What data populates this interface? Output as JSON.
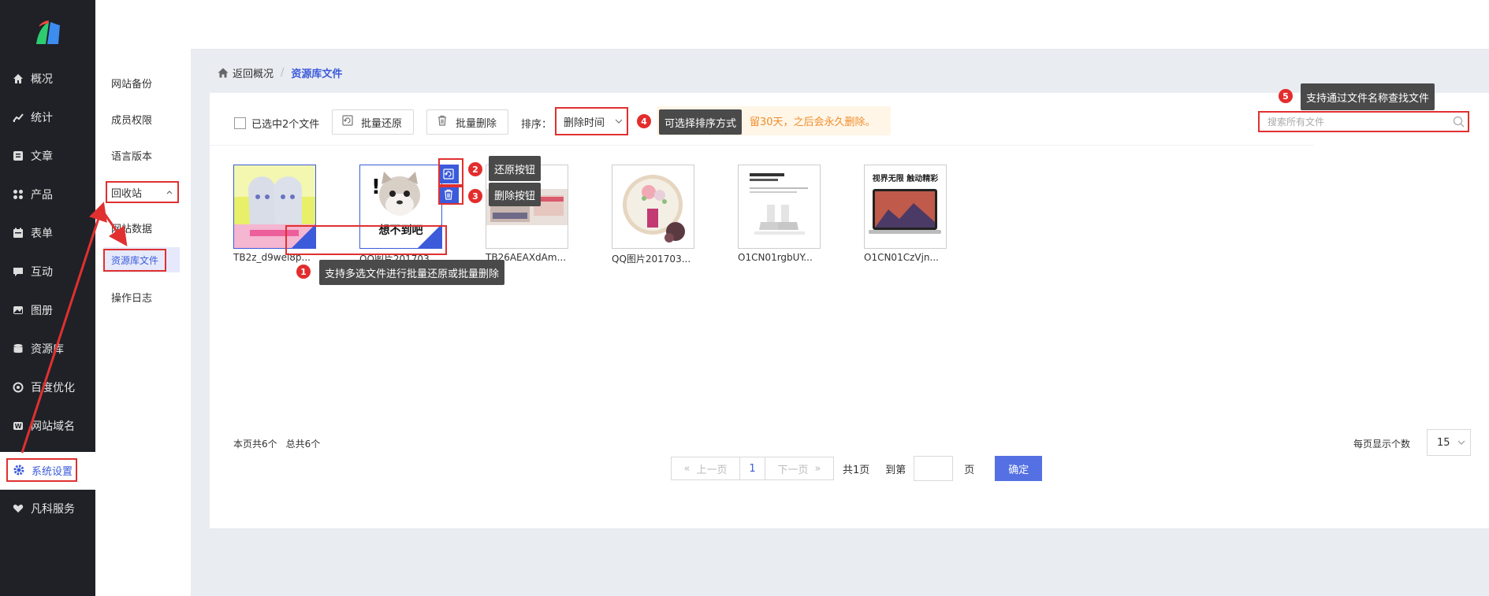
{
  "nav": {
    "items": [
      {
        "label": "概况",
        "icon": "home-icon"
      },
      {
        "label": "统计",
        "icon": "chart-icon"
      },
      {
        "label": "文章",
        "icon": "article-icon"
      },
      {
        "label": "产品",
        "icon": "grid-icon"
      },
      {
        "label": "表单",
        "icon": "form-icon"
      },
      {
        "label": "互动",
        "icon": "chat-icon"
      },
      {
        "label": "图册",
        "icon": "album-icon"
      },
      {
        "label": "资源库",
        "icon": "database-icon"
      },
      {
        "label": "百度优化",
        "icon": "seo-icon"
      },
      {
        "label": "网站域名",
        "icon": "domain-icon"
      }
    ],
    "settings_label": "系统设置",
    "service_label": "凡科服务"
  },
  "subnav": {
    "items": [
      "网站备份",
      "成员权限",
      "语言版本"
    ],
    "recycle_label": "回收站",
    "site_data_label": "网站数据",
    "resource_label": "资源库文件",
    "log_label": "操作日志"
  },
  "breadcrumb": {
    "back": "返回概况",
    "separator": "/",
    "current": "资源库文件"
  },
  "toolbar": {
    "selected_label": "已选中2个文件",
    "restore_label": "批量还原",
    "delete_label": "批量删除",
    "sort_label": "排序：",
    "sort_value": "删除时间",
    "notice_text": "留30天，之后会永久删除。",
    "search_placeholder": "搜索所有文件"
  },
  "tips": {
    "t1": "支持多选文件进行批量还原或批量删除",
    "t2": "还原按钮",
    "t3": "删除按钮",
    "t4": "可选择排序方式",
    "t5": "支持通过文件名称查找文件"
  },
  "badges": [
    "1",
    "2",
    "3",
    "4",
    "5"
  ],
  "files": [
    {
      "name": "TB2z_d9wel8p...",
      "selected": true
    },
    {
      "name": "QQ图片201703...",
      "selected": true,
      "caption": "想不到吧"
    },
    {
      "name": "TB26AEAXdAm...",
      "selected": false
    },
    {
      "name": "QQ图片201703...",
      "selected": false
    },
    {
      "name": "O1CN01rgbUY...",
      "selected": false
    },
    {
      "name": "O1CN01CzVjn...",
      "selected": false,
      "caption": "视界无限 触动精彩"
    }
  ],
  "footer": {
    "page_count": "本页共6个",
    "total_count": "总共6个",
    "prev": "上一页",
    "page": "1",
    "next": "下一页",
    "pages_total": "共1页",
    "goto_label": "到第",
    "goto_suffix": "页",
    "confirm": "确定",
    "per_page_label": "每页显示个数",
    "per_page_value": "15"
  },
  "colors": {
    "accent": "#3b5bdb",
    "highlight": "#e03030",
    "sidebar": "#1f2127",
    "notice": "#f08c2a"
  }
}
